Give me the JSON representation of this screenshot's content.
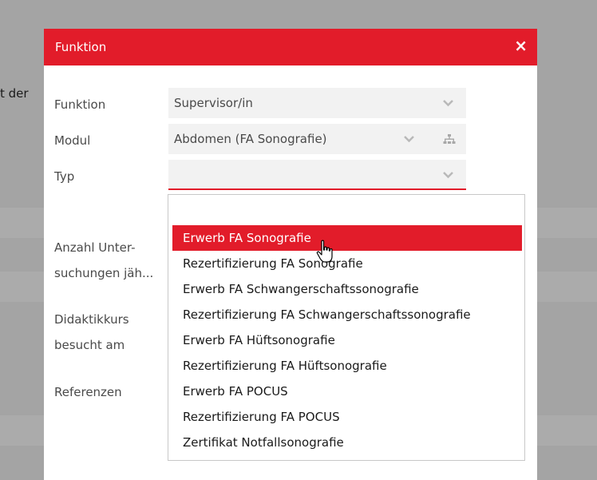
{
  "background": {
    "partial_text": "t der"
  },
  "modal": {
    "title": "Funktion",
    "close_label": "×",
    "fields": {
      "funktion": {
        "label": "Funktion",
        "value": "Supervisor/in"
      },
      "modul": {
        "label": "Modul",
        "value": "Abdomen (FA Sonografie)"
      },
      "typ": {
        "label": "Typ",
        "value": ""
      },
      "anzahl": {
        "label_line1": "Anzahl Unter-",
        "label_line2": "suchungen jäh..."
      },
      "didaktik": {
        "label_line1": "Didaktikkurs",
        "label_line2": "besucht am"
      },
      "referenzen": {
        "label": "Referenzen"
      }
    }
  },
  "dropdown": {
    "search_value": "",
    "selected_index": 0,
    "options": [
      "Erwerb FA Sonografie",
      "Rezertifizierung FA Sonografie",
      "Erwerb FA Schwangerschaftssonografie",
      "Rezertifizierung FA Schwangerschaftssonografie",
      "Erwerb FA Hüftsonografie",
      "Rezertifizierung FA Hüftsonografie",
      "Erwerb FA POCUS",
      "Rezertifizierung FA POCUS",
      "Zertifikat Notfallsonografie"
    ]
  },
  "colors": {
    "accent": "#e21c2a",
    "overlay": "#a4a4a4",
    "field_bg": "#f2f2f2",
    "text": "#4a4a4a"
  },
  "icons": [
    "close-icon",
    "chevron-down-icon",
    "tree-icon",
    "hand-cursor-icon"
  ]
}
